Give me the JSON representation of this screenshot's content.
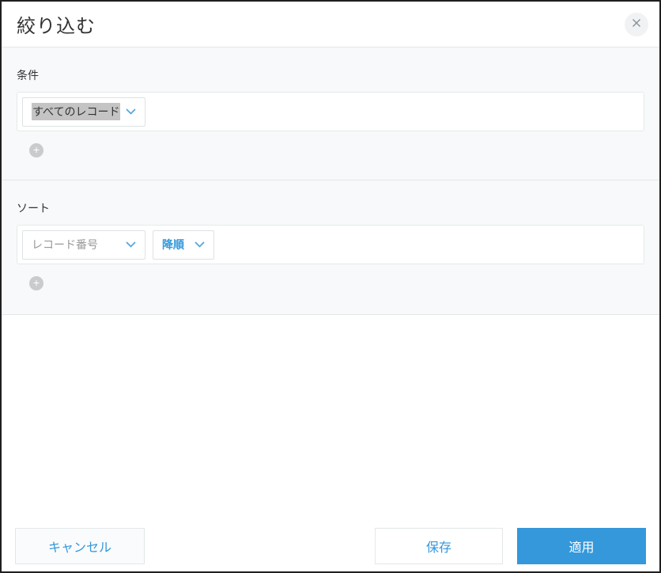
{
  "dialog": {
    "title": "絞り込む"
  },
  "icons": {
    "close": "×",
    "chevron_down": "∨",
    "add": "+"
  },
  "condition": {
    "label": "条件",
    "dropdown_value": "すべてのレコード"
  },
  "sort": {
    "label": "ソート",
    "field_value": "レコード番号",
    "order_value": "降順"
  },
  "footer": {
    "cancel": "キャンセル",
    "save": "保存",
    "apply": "適用"
  },
  "colors": {
    "accent": "#3498db",
    "section_bg": "#f7f9fa",
    "border": "#e3e7e8",
    "selection_highlight": "#c4c4c4",
    "chevron": "#55a7e0"
  }
}
